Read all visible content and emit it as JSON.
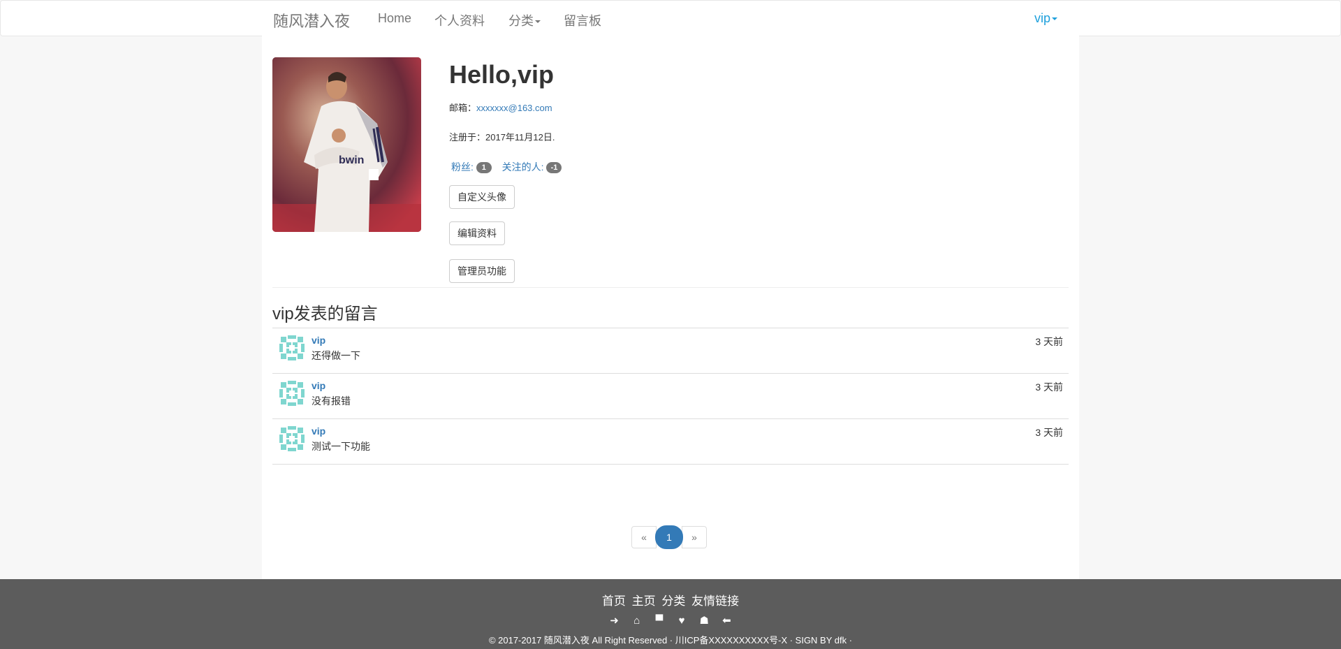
{
  "nav": {
    "brand": "随风潜入夜",
    "items": [
      {
        "label": "Home"
      },
      {
        "label": "个人资料"
      },
      {
        "label": "分类",
        "dropdown": true
      },
      {
        "label": "留言板"
      }
    ],
    "user": "vip"
  },
  "profile": {
    "greeting": "Hello,vip",
    "email_label": "邮箱：",
    "email": "xxxxxxx@163.com",
    "registered": "注册于：2017年11月12日.",
    "followers_label": "粉丝:",
    "followers_count": "1",
    "following_label": "关注的人:",
    "following_count": "-1",
    "buttons": {
      "custom_avatar": "自定义头像",
      "edit_profile": "编辑资料",
      "admin": "管理员功能"
    }
  },
  "posts": {
    "title": "vip发表的留言",
    "items": [
      {
        "author": "vip",
        "body": "还得做一下",
        "time": "3 天前"
      },
      {
        "author": "vip",
        "body": "没有报错",
        "time": "3 天前"
      },
      {
        "author": "vip",
        "body": "测试一下功能",
        "time": "3 天前"
      }
    ]
  },
  "pagination": {
    "prev": "«",
    "current": "1",
    "next": "»"
  },
  "footer": {
    "links": [
      "首页",
      "主页",
      "分类",
      "友情链接"
    ],
    "icons": [
      {
        "name": "arrow-right-icon",
        "glyph": "➜"
      },
      {
        "name": "home-icon",
        "glyph": "⌂"
      },
      {
        "name": "comment-icon",
        "glyph": "▀"
      },
      {
        "name": "heart-icon",
        "glyph": "♥"
      },
      {
        "name": "user-icon",
        "glyph": "☗"
      },
      {
        "name": "arrow-left-icon",
        "glyph": "⬅"
      }
    ],
    "copyright": "© 2017-2017 随风潜入夜 All Right Reserved · 川ICP备XXXXXXXXXX号-X · SIGN BY dfk ·"
  },
  "colors": {
    "brand_blue": "#337ab7",
    "user_link": "#1ea0dc",
    "footer_bg": "#5c5c5c",
    "badge_gray": "#777777"
  }
}
